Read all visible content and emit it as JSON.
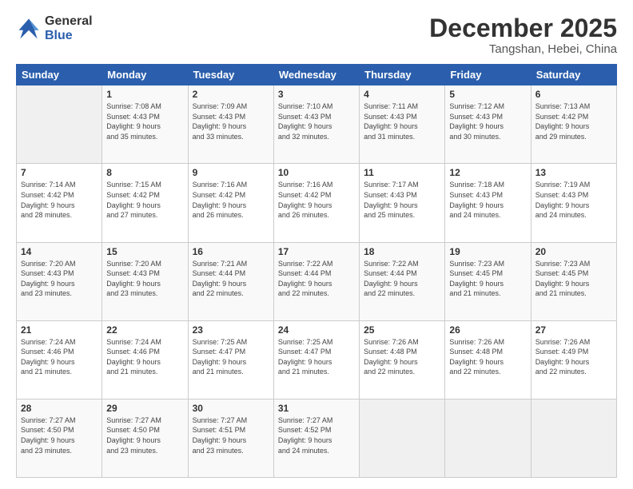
{
  "logo": {
    "general": "General",
    "blue": "Blue"
  },
  "header": {
    "title": "December 2025",
    "subtitle": "Tangshan, Hebei, China"
  },
  "weekdays": [
    "Sunday",
    "Monday",
    "Tuesday",
    "Wednesday",
    "Thursday",
    "Friday",
    "Saturday"
  ],
  "weeks": [
    [
      {
        "day": "",
        "sunrise": "",
        "sunset": "",
        "daylight": ""
      },
      {
        "day": "1",
        "sunrise": "Sunrise: 7:08 AM",
        "sunset": "Sunset: 4:43 PM",
        "daylight": "Daylight: 9 hours and 35 minutes."
      },
      {
        "day": "2",
        "sunrise": "Sunrise: 7:09 AM",
        "sunset": "Sunset: 4:43 PM",
        "daylight": "Daylight: 9 hours and 33 minutes."
      },
      {
        "day": "3",
        "sunrise": "Sunrise: 7:10 AM",
        "sunset": "Sunset: 4:43 PM",
        "daylight": "Daylight: 9 hours and 32 minutes."
      },
      {
        "day": "4",
        "sunrise": "Sunrise: 7:11 AM",
        "sunset": "Sunset: 4:43 PM",
        "daylight": "Daylight: 9 hours and 31 minutes."
      },
      {
        "day": "5",
        "sunrise": "Sunrise: 7:12 AM",
        "sunset": "Sunset: 4:43 PM",
        "daylight": "Daylight: 9 hours and 30 minutes."
      },
      {
        "day": "6",
        "sunrise": "Sunrise: 7:13 AM",
        "sunset": "Sunset: 4:42 PM",
        "daylight": "Daylight: 9 hours and 29 minutes."
      }
    ],
    [
      {
        "day": "7",
        "sunrise": "Sunrise: 7:14 AM",
        "sunset": "Sunset: 4:42 PM",
        "daylight": "Daylight: 9 hours and 28 minutes."
      },
      {
        "day": "8",
        "sunrise": "Sunrise: 7:15 AM",
        "sunset": "Sunset: 4:42 PM",
        "daylight": "Daylight: 9 hours and 27 minutes."
      },
      {
        "day": "9",
        "sunrise": "Sunrise: 7:16 AM",
        "sunset": "Sunset: 4:42 PM",
        "daylight": "Daylight: 9 hours and 26 minutes."
      },
      {
        "day": "10",
        "sunrise": "Sunrise: 7:16 AM",
        "sunset": "Sunset: 4:42 PM",
        "daylight": "Daylight: 9 hours and 26 minutes."
      },
      {
        "day": "11",
        "sunrise": "Sunrise: 7:17 AM",
        "sunset": "Sunset: 4:43 PM",
        "daylight": "Daylight: 9 hours and 25 minutes."
      },
      {
        "day": "12",
        "sunrise": "Sunrise: 7:18 AM",
        "sunset": "Sunset: 4:43 PM",
        "daylight": "Daylight: 9 hours and 24 minutes."
      },
      {
        "day": "13",
        "sunrise": "Sunrise: 7:19 AM",
        "sunset": "Sunset: 4:43 PM",
        "daylight": "Daylight: 9 hours and 24 minutes."
      }
    ],
    [
      {
        "day": "14",
        "sunrise": "Sunrise: 7:20 AM",
        "sunset": "Sunset: 4:43 PM",
        "daylight": "Daylight: 9 hours and 23 minutes."
      },
      {
        "day": "15",
        "sunrise": "Sunrise: 7:20 AM",
        "sunset": "Sunset: 4:43 PM",
        "daylight": "Daylight: 9 hours and 23 minutes."
      },
      {
        "day": "16",
        "sunrise": "Sunrise: 7:21 AM",
        "sunset": "Sunset: 4:44 PM",
        "daylight": "Daylight: 9 hours and 22 minutes."
      },
      {
        "day": "17",
        "sunrise": "Sunrise: 7:22 AM",
        "sunset": "Sunset: 4:44 PM",
        "daylight": "Daylight: 9 hours and 22 minutes."
      },
      {
        "day": "18",
        "sunrise": "Sunrise: 7:22 AM",
        "sunset": "Sunset: 4:44 PM",
        "daylight": "Daylight: 9 hours and 22 minutes."
      },
      {
        "day": "19",
        "sunrise": "Sunrise: 7:23 AM",
        "sunset": "Sunset: 4:45 PM",
        "daylight": "Daylight: 9 hours and 21 minutes."
      },
      {
        "day": "20",
        "sunrise": "Sunrise: 7:23 AM",
        "sunset": "Sunset: 4:45 PM",
        "daylight": "Daylight: 9 hours and 21 minutes."
      }
    ],
    [
      {
        "day": "21",
        "sunrise": "Sunrise: 7:24 AM",
        "sunset": "Sunset: 4:46 PM",
        "daylight": "Daylight: 9 hours and 21 minutes."
      },
      {
        "day": "22",
        "sunrise": "Sunrise: 7:24 AM",
        "sunset": "Sunset: 4:46 PM",
        "daylight": "Daylight: 9 hours and 21 minutes."
      },
      {
        "day": "23",
        "sunrise": "Sunrise: 7:25 AM",
        "sunset": "Sunset: 4:47 PM",
        "daylight": "Daylight: 9 hours and 21 minutes."
      },
      {
        "day": "24",
        "sunrise": "Sunrise: 7:25 AM",
        "sunset": "Sunset: 4:47 PM",
        "daylight": "Daylight: 9 hours and 21 minutes."
      },
      {
        "day": "25",
        "sunrise": "Sunrise: 7:26 AM",
        "sunset": "Sunset: 4:48 PM",
        "daylight": "Daylight: 9 hours and 22 minutes."
      },
      {
        "day": "26",
        "sunrise": "Sunrise: 7:26 AM",
        "sunset": "Sunset: 4:48 PM",
        "daylight": "Daylight: 9 hours and 22 minutes."
      },
      {
        "day": "27",
        "sunrise": "Sunrise: 7:26 AM",
        "sunset": "Sunset: 4:49 PM",
        "daylight": "Daylight: 9 hours and 22 minutes."
      }
    ],
    [
      {
        "day": "28",
        "sunrise": "Sunrise: 7:27 AM",
        "sunset": "Sunset: 4:50 PM",
        "daylight": "Daylight: 9 hours and 23 minutes."
      },
      {
        "day": "29",
        "sunrise": "Sunrise: 7:27 AM",
        "sunset": "Sunset: 4:50 PM",
        "daylight": "Daylight: 9 hours and 23 minutes."
      },
      {
        "day": "30",
        "sunrise": "Sunrise: 7:27 AM",
        "sunset": "Sunset: 4:51 PM",
        "daylight": "Daylight: 9 hours and 23 minutes."
      },
      {
        "day": "31",
        "sunrise": "Sunrise: 7:27 AM",
        "sunset": "Sunset: 4:52 PM",
        "daylight": "Daylight: 9 hours and 24 minutes."
      },
      {
        "day": "",
        "sunrise": "",
        "sunset": "",
        "daylight": ""
      },
      {
        "day": "",
        "sunrise": "",
        "sunset": "",
        "daylight": ""
      },
      {
        "day": "",
        "sunrise": "",
        "sunset": "",
        "daylight": ""
      }
    ]
  ]
}
